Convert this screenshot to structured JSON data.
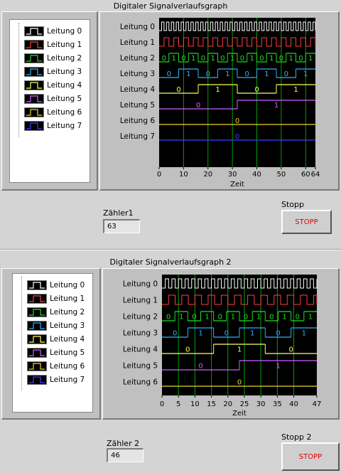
{
  "graph1": {
    "title": "Digitaler Signalverlaufsgraph",
    "xlabel": "Zeit",
    "legend": [
      "Leitung 0",
      "Leitung 1",
      "Leitung 2",
      "Leitung 3",
      "Leitung 4",
      "Leitung 5",
      "Leitung 6",
      "Leitung 7"
    ],
    "channel_labels": [
      "Leitung 0",
      "Leitung 1",
      "Leitung 2",
      "Leitung 3",
      "Leitung 4",
      "Leitung 5",
      "Leitung 6",
      "Leitung 7"
    ],
    "ticks": [
      "0",
      "10",
      "20",
      "30",
      "40",
      "50",
      "60",
      "64"
    ]
  },
  "graph2": {
    "title": "Digitaler Signalverlaufsgraph 2",
    "xlabel": "Zeit",
    "legend": [
      "Leitung 0",
      "Leitung 1",
      "Leitung 2",
      "Leitung 3",
      "Leitung 4",
      "Leitung 5",
      "Leitung 6",
      "Leitung 7"
    ],
    "channel_labels": [
      "Leitung 0",
      "Leitung 1",
      "Leitung 2",
      "Leitung 3",
      "Leitung 4",
      "Leitung 5",
      "Leitung 6"
    ],
    "ticks": [
      "0",
      "5",
      "10",
      "15",
      "20",
      "25",
      "30",
      "35",
      "40",
      "47"
    ]
  },
  "counter1": {
    "label": "Zähler1",
    "value": "63"
  },
  "counter2": {
    "label": "Zähler 2",
    "value": "46"
  },
  "stop1": {
    "label": "Stopp",
    "button": "STOPP"
  },
  "stop2": {
    "label": "Stopp 2",
    "button": "STOPP"
  },
  "colors": {
    "line0": "#ffffff",
    "line1": "#ff4040",
    "line2": "#20e020",
    "line3": "#30b0ff",
    "line4": "#ffff60",
    "line5": "#d060ff",
    "line6": "#f0d030",
    "line7": "#4040ff",
    "grid": "#00a000",
    "button_text": "#e00000"
  },
  "chart_data": [
    {
      "type": "digital-waveform",
      "title": "Digitaler Signalverlaufsgraph",
      "xlabel": "Zeit",
      "xlim": [
        0,
        64
      ],
      "channels": [
        "Leitung 0",
        "Leitung 1",
        "Leitung 2",
        "Leitung 3",
        "Leitung 4",
        "Leitung 5",
        "Leitung 6",
        "Leitung 7"
      ],
      "samples": 64,
      "bus_values": {
        "Leitung 2": [
          "0",
          "1",
          "0",
          "1",
          "0",
          "1",
          "0",
          "1",
          "0",
          "1",
          "0",
          "1",
          "0",
          "1",
          "0",
          "1"
        ],
        "Leitung 3": [
          "0",
          "1",
          "0",
          "1",
          "0",
          "1",
          "0",
          "1"
        ],
        "Leitung 4": [
          "0",
          "1",
          "0",
          "1"
        ],
        "Leitung 5": [
          "0",
          "1"
        ],
        "Leitung 6": [
          "0"
        ],
        "Leitung 7": [
          "0"
        ]
      }
    },
    {
      "type": "digital-waveform",
      "title": "Digitaler Signalverlaufsgraph 2",
      "xlabel": "Zeit",
      "xlim": [
        0,
        47
      ],
      "channels": [
        "Leitung 0",
        "Leitung 1",
        "Leitung 2",
        "Leitung 3",
        "Leitung 4",
        "Leitung 5",
        "Leitung 6"
      ],
      "samples": 47,
      "bus_values": {
        "Leitung 2": [
          "0",
          "1",
          "0",
          "1",
          "0",
          "1",
          "0",
          "1",
          "0",
          "1",
          "0",
          "1"
        ],
        "Leitung 3": [
          "0",
          "1",
          "0",
          "1",
          "0",
          "1"
        ],
        "Leitung 4": [
          "0",
          "1",
          "0"
        ],
        "Leitung 5": [
          "0",
          "1"
        ],
        "Leitung 6": [
          "0"
        ]
      }
    }
  ]
}
